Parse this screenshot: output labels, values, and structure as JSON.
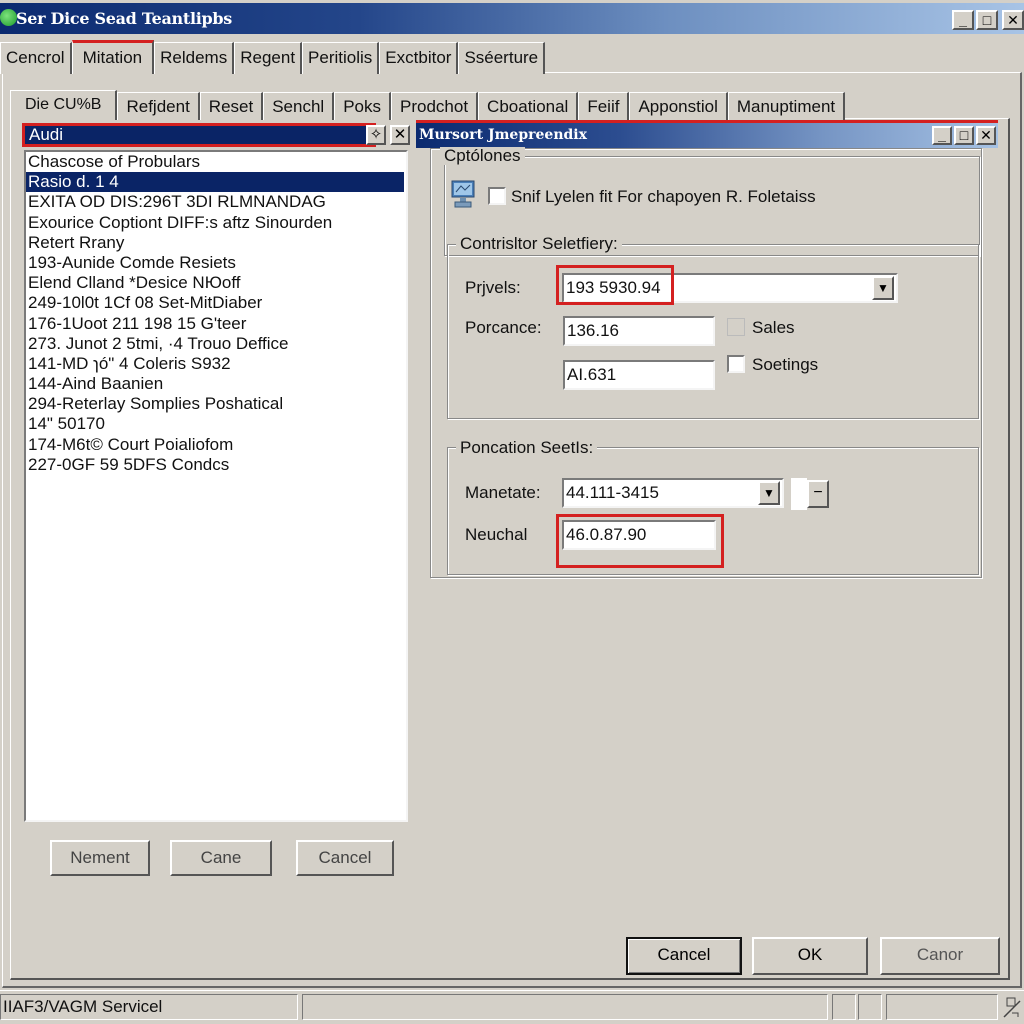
{
  "window": {
    "title": "Ser Dice Sead Teantlipbs",
    "icon": "app-globe-icon",
    "controls": {
      "minimize": "_",
      "maximize": "□",
      "close": "✕"
    }
  },
  "top_tabs": [
    {
      "label": "Cencrol",
      "active": false
    },
    {
      "label": "Mitation",
      "active": true
    },
    {
      "label": "Reldems",
      "active": false
    },
    {
      "label": "Regent",
      "active": false
    },
    {
      "label": "Peritiolis",
      "active": false
    },
    {
      "label": "Exctbitor",
      "active": false
    },
    {
      "label": "Sséerture",
      "active": false
    }
  ],
  "second_tabs": [
    {
      "label": "Die CU%B",
      "active": true
    },
    {
      "label": "Refjdent",
      "active": false
    },
    {
      "label": "Reset",
      "active": false
    },
    {
      "label": "Senchl",
      "active": false
    },
    {
      "label": "Poks",
      "active": false
    },
    {
      "label": "Prodchot",
      "active": false
    },
    {
      "label": "Cboational",
      "active": false
    },
    {
      "label": "Feiif",
      "active": false
    },
    {
      "label": "Apponstiol",
      "active": false
    },
    {
      "label": "Manuptiment",
      "active": false
    }
  ],
  "left_pane": {
    "header": "Audi",
    "header_buttons": {
      "pin": "✧",
      "close": "✕"
    },
    "items": [
      {
        "text": "Chascose of Probulars",
        "selected": false
      },
      {
        "text": "Rasio d. 1 4",
        "selected": true
      },
      {
        "text": "EXITA OD DIS:296T 3DI RLMNANDAG",
        "selected": false
      },
      {
        "text": "Exourice Coptiont DIFF:s aftz Sinourden",
        "selected": false
      },
      {
        "text": "Retert Rrany",
        "selected": false
      },
      {
        "text": "193-Aunide Comde Resiets",
        "selected": false
      },
      {
        "text": "Elend Clland *Desice NЮoff",
        "selected": false
      },
      {
        "text": "249-10l0t 1Cf 08 Set-MitDiaber",
        "selected": false
      },
      {
        "text": "176-1Uoot 211  198 15 G'teer",
        "selected": false
      },
      {
        "text": "273. Junot 2 5tmi, ·4 Trouo Deffice",
        "selected": false
      },
      {
        "text": "141-MD ɿó\" 4 Coleris S932",
        "selected": false
      },
      {
        "text": "144-Aind Baanien",
        "selected": false
      },
      {
        "text": "294-Reterlay Somplies Poshatical",
        "selected": false
      },
      {
        "text": "14\" 50170",
        "selected": false
      },
      {
        "text": "174-M6t© Court Poialiofom",
        "selected": false
      },
      {
        "text": "227-0GF 59 5DFS Condcs",
        "selected": false
      }
    ],
    "buttons": {
      "nement": "Nement",
      "cane": "Cane",
      "cancel": "Cancel"
    }
  },
  "dialog": {
    "title": "Mursort Jmepreendix",
    "controls": {
      "minimize": "_",
      "maximize": "□",
      "close": "✕"
    },
    "options_group": {
      "label": "Cptólones",
      "checkbox_label": "Snif Lyelen fit For chapoyen R. Foletaiss",
      "checkbox_checked": false,
      "icon": "monitor-icon"
    },
    "controller_group": {
      "label": "Contrisltor Seletfiery:",
      "prjvels_label": "Prjvels:",
      "prjvels_value": "193 5930.94",
      "porcance_label": "Porcance:",
      "porcance_value": "136.16",
      "second_value": "AI.631",
      "sales_label": "Sales",
      "sales_checked": false,
      "sales_disabled": true,
      "soetings_label": "Soetings",
      "soetings_checked": false
    },
    "poncation_group": {
      "label": "Poncation SeetIs:",
      "manetate_label": "Manetate:",
      "manetate_value": "44.111-3415",
      "minus_button": "−",
      "neuchal_label": "Neuchal",
      "neuchal_value": "46.0.87.90"
    },
    "buttons": {
      "cancel": "Cancel",
      "ok": "OK",
      "canor": "Canor"
    }
  },
  "statusbar": {
    "text": "IIAF3/VAGM Servicel",
    "icon": "network-cable-icon"
  },
  "colors": {
    "highlight_red": "#d42020",
    "selection_navy": "#0a2466",
    "face": "#d4d0c8"
  }
}
